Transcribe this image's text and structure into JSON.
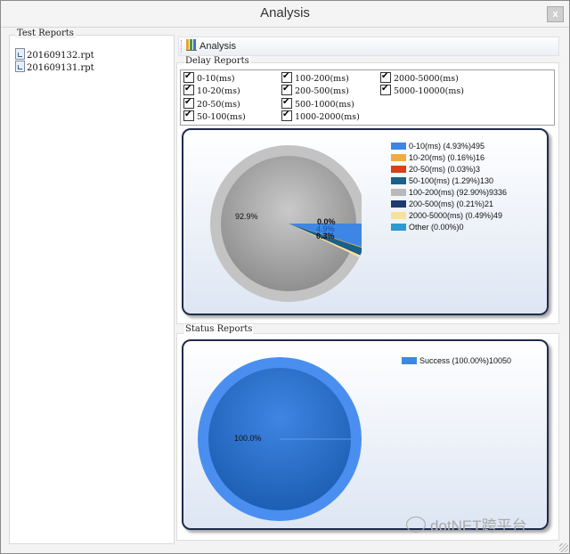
{
  "window": {
    "title": "Analysis",
    "close_label": "x"
  },
  "test_reports": {
    "title": "Test Reports",
    "files": [
      "201609132.rpt",
      "201609131.rpt"
    ]
  },
  "toolbar": {
    "analysis_label": "Analysis"
  },
  "delay_reports": {
    "title": "Delay  Reports",
    "options": [
      {
        "label": "0-10(ms)",
        "checked": true
      },
      {
        "label": "10-20(ms)",
        "checked": true
      },
      {
        "label": "20-50(ms)",
        "checked": true
      },
      {
        "label": "50-100(ms)",
        "checked": true
      },
      {
        "label": "100-200(ms)",
        "checked": true
      },
      {
        "label": "200-500(ms)",
        "checked": true
      },
      {
        "label": "500-1000(ms)",
        "checked": true
      },
      {
        "label": "1000-2000(ms)",
        "checked": true
      },
      {
        "label": "2000-5000(ms)",
        "checked": true
      },
      {
        "label": "5000-10000(ms)",
        "checked": true
      }
    ]
  },
  "status_reports": {
    "title": "Status Reports"
  },
  "chart_data": [
    {
      "type": "pie",
      "title": "",
      "legend": "right",
      "slice_labels": [
        "92.9%",
        "0.0%",
        "4.9%",
        "0.3%"
      ],
      "series": [
        {
          "label": "0-10(ms) (4.93%)495",
          "value": 495,
          "color": "#3d86e6"
        },
        {
          "label": "10-20(ms) (0.16%)16",
          "value": 16,
          "color": "#f0ad3c"
        },
        {
          "label": "20-50(ms) (0.03%)3",
          "value": 3,
          "color": "#d6401a"
        },
        {
          "label": "50-100(ms) (1.29%)130",
          "value": 130,
          "color": "#15638d"
        },
        {
          "label": "100-200(ms) (92.90%)9336",
          "value": 9336,
          "color": "#b9b9b9"
        },
        {
          "label": "200-500(ms) (0.21%)21",
          "value": 21,
          "color": "#1c3a6e"
        },
        {
          "label": "2000-5000(ms) (0.49%)49",
          "value": 49,
          "color": "#f7e29a"
        },
        {
          "label": "Other (0.00%)0",
          "value": 0,
          "color": "#2d9ad2"
        }
      ]
    },
    {
      "type": "pie",
      "title": "",
      "legend": "top-right",
      "slice_labels": [
        "100.0%"
      ],
      "series": [
        {
          "label": "Success (100.00%)10050",
          "value": 10050,
          "color": "#3d86e6"
        }
      ]
    }
  ],
  "watermark": {
    "text": "dotNET跨平台"
  }
}
